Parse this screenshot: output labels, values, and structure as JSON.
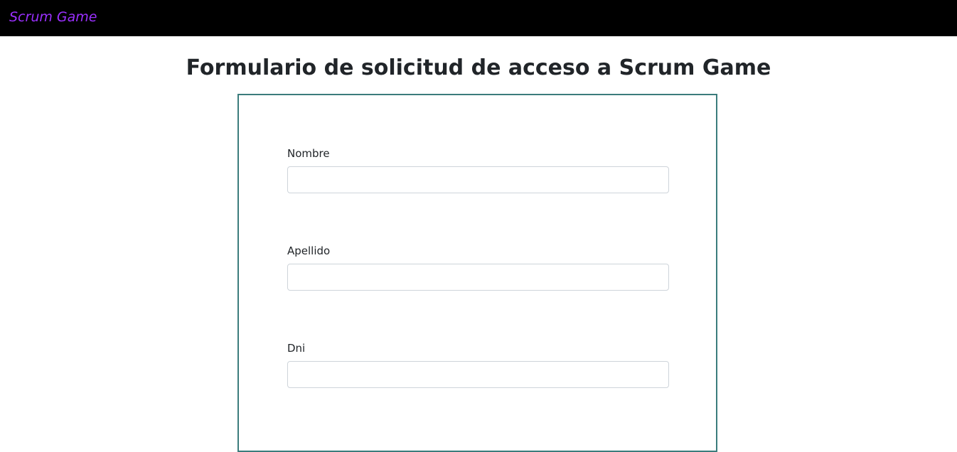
{
  "navbar": {
    "brand": "Scrum Game"
  },
  "page": {
    "title": "Formulario de solicitud de acceso a Scrum Game"
  },
  "form": {
    "fields": [
      {
        "label": "Nombre",
        "value": "",
        "placeholder": ""
      },
      {
        "label": "Apellido",
        "value": "",
        "placeholder": ""
      },
      {
        "label": "Dni",
        "value": "",
        "placeholder": ""
      }
    ]
  },
  "colors": {
    "navbar_bg": "#000000",
    "brand": "#9b30ff",
    "card_border": "#3b7c7c",
    "input_border": "#ced4da",
    "text": "#212529"
  }
}
